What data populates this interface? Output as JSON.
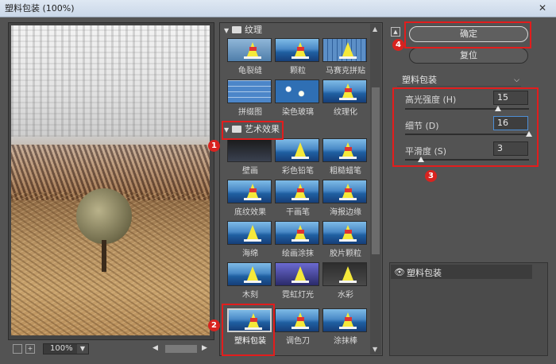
{
  "window": {
    "title": "塑料包装 (100%)",
    "close_glyph": "✕"
  },
  "preview": {
    "zoom": "100%"
  },
  "gallery": {
    "categories": [
      {
        "label": "纹理",
        "expanded": true
      },
      {
        "label": "艺术效果",
        "expanded": true
      }
    ],
    "texture_items": [
      "龟裂缝",
      "颗粒",
      "马赛克拼贴",
      "拼缀图",
      "染色玻璃",
      "纹理化"
    ],
    "artistic_items": [
      "壁画",
      "彩色铅笔",
      "粗糙蜡笔",
      "底纹效果",
      "干画笔",
      "海报边缘",
      "海绵",
      "绘画涂抹",
      "胶片颗粒",
      "木刻",
      "霓虹灯光",
      "水彩",
      "塑料包装",
      "调色刀",
      "涂抹棒"
    ],
    "selected": "塑料包装"
  },
  "actions": {
    "ok_label": "确定",
    "reset_label": "复位"
  },
  "filter_settings": {
    "selected_filter": "塑料包装",
    "params": [
      {
        "label": "高光强度 (H)",
        "value": "15",
        "slider_fraction": 0.75
      },
      {
        "label": "细节 (D)",
        "value": "16",
        "slider_fraction": 1.0
      },
      {
        "label": "平滑度 (S)",
        "value": "3",
        "slider_fraction": 0.13
      }
    ]
  },
  "layers": {
    "items": [
      "塑料包装"
    ]
  },
  "annotations": [
    "1",
    "2",
    "3",
    "4"
  ],
  "colors": {
    "annotation_red": "#e21d1d",
    "focus_blue": "#4d8fd6"
  }
}
